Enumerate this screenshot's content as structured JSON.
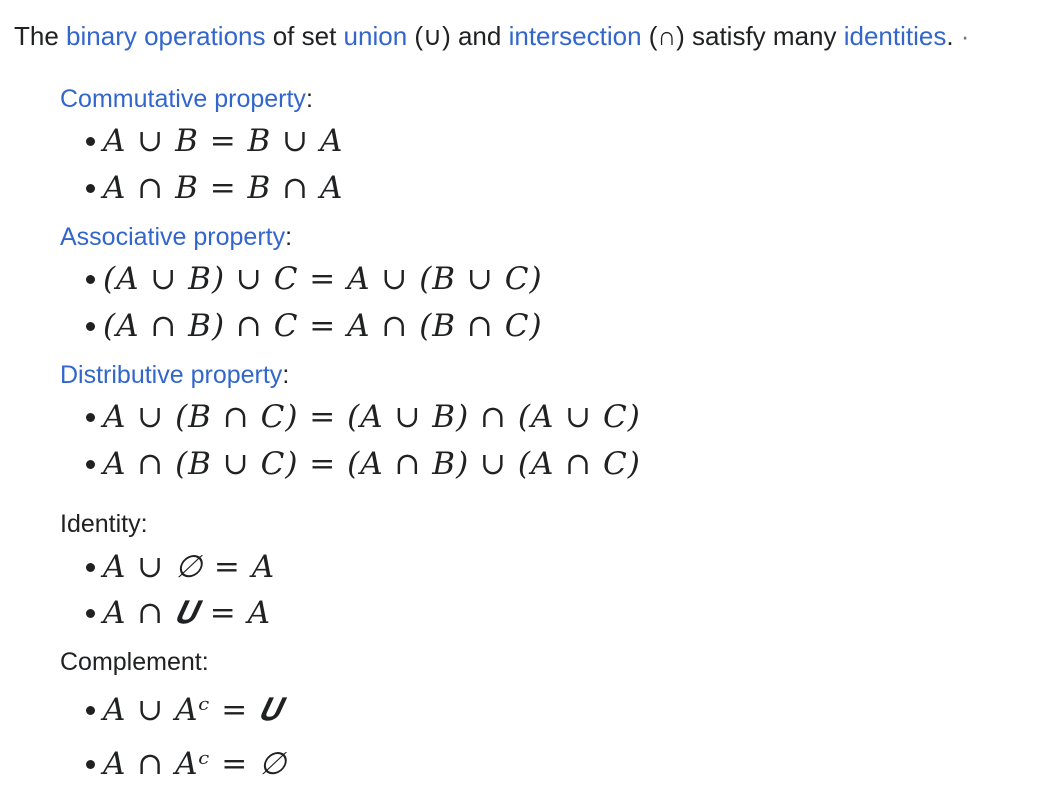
{
  "intro": {
    "t1": "The ",
    "link_binary": "binary operations",
    "t2": " of set ",
    "link_union": "union",
    "t3": " (∪) and ",
    "link_intersection": "intersection",
    "t4": " (∩) satisfy many ",
    "link_identities": "identities",
    "t5": ".",
    "edge": " ·"
  },
  "sections": [
    {
      "heading_link": "Commutative property",
      "heading_suffix": ":",
      "items": [
        "A ∪ B = B ∪ A",
        "A ∩ B = B ∩ A"
      ]
    },
    {
      "heading_link": "Associative property",
      "heading_suffix": ":",
      "items": [
        "(A ∪ B) ∪ C = A ∪ (B ∪ C)",
        "(A ∩ B) ∩ C = A ∩ (B ∩ C)"
      ]
    },
    {
      "heading_link": "Distributive property",
      "heading_suffix": ":",
      "items": [
        "A ∪ (B ∩ C) = (A ∪ B) ∩ (A ∪ C)",
        "A ∩ (B ∪ C) = (A ∩ B) ∪ (A ∩ C)"
      ]
    },
    {
      "heading_text": "Identity:",
      "items": [
        "A ∪ ∅ = A",
        "A ∩ 𝑼 = A"
      ]
    },
    {
      "heading_text": "Complement:",
      "items": [
        "A ∪ Aᶜ = 𝑼",
        "A ∩ Aᶜ = ∅"
      ]
    }
  ]
}
